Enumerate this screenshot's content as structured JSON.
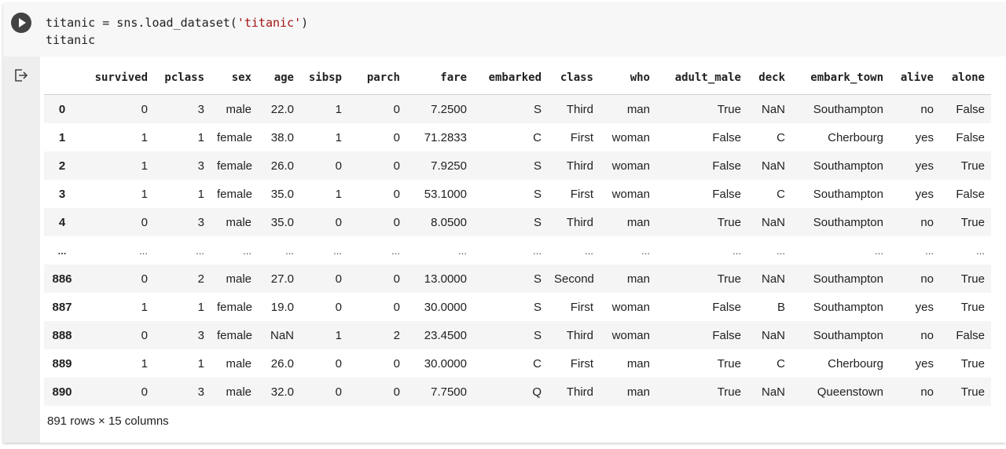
{
  "code": {
    "line1_prefix": "titanic = sns.load_dataset(",
    "line1_string": "'titanic'",
    "line1_suffix": ")",
    "line2": "titanic"
  },
  "icons": {
    "run": "play-circle-icon",
    "output": "output-redirect-icon"
  },
  "colors": {
    "code_bg": "#f7f7f7",
    "gutter_bg": "#eeeeee",
    "string": "#a31515",
    "row_stripe": "#f5f5f5"
  },
  "table": {
    "columns": [
      "",
      "survived",
      "pclass",
      "sex",
      "age",
      "sibsp",
      "parch",
      "fare",
      "embarked",
      "class",
      "who",
      "adult_male",
      "deck",
      "embark_town",
      "alive",
      "alone"
    ],
    "rows": [
      [
        "0",
        "0",
        "3",
        "male",
        "22.0",
        "1",
        "0",
        "7.2500",
        "S",
        "Third",
        "man",
        "True",
        "NaN",
        "Southampton",
        "no",
        "False"
      ],
      [
        "1",
        "1",
        "1",
        "female",
        "38.0",
        "1",
        "0",
        "71.2833",
        "C",
        "First",
        "woman",
        "False",
        "C",
        "Cherbourg",
        "yes",
        "False"
      ],
      [
        "2",
        "1",
        "3",
        "female",
        "26.0",
        "0",
        "0",
        "7.9250",
        "S",
        "Third",
        "woman",
        "False",
        "NaN",
        "Southampton",
        "yes",
        "True"
      ],
      [
        "3",
        "1",
        "1",
        "female",
        "35.0",
        "1",
        "0",
        "53.1000",
        "S",
        "First",
        "woman",
        "False",
        "C",
        "Southampton",
        "yes",
        "False"
      ],
      [
        "4",
        "0",
        "3",
        "male",
        "35.0",
        "0",
        "0",
        "8.0500",
        "S",
        "Third",
        "man",
        "True",
        "NaN",
        "Southampton",
        "no",
        "True"
      ],
      [
        "...",
        "...",
        "...",
        "...",
        "...",
        "...",
        "...",
        "...",
        "...",
        "...",
        "...",
        "...",
        "...",
        "...",
        "...",
        "..."
      ],
      [
        "886",
        "0",
        "2",
        "male",
        "27.0",
        "0",
        "0",
        "13.0000",
        "S",
        "Second",
        "man",
        "True",
        "NaN",
        "Southampton",
        "no",
        "True"
      ],
      [
        "887",
        "1",
        "1",
        "female",
        "19.0",
        "0",
        "0",
        "30.0000",
        "S",
        "First",
        "woman",
        "False",
        "B",
        "Southampton",
        "yes",
        "True"
      ],
      [
        "888",
        "0",
        "3",
        "female",
        "NaN",
        "1",
        "2",
        "23.4500",
        "S",
        "Third",
        "woman",
        "False",
        "NaN",
        "Southampton",
        "no",
        "False"
      ],
      [
        "889",
        "1",
        "1",
        "male",
        "26.0",
        "0",
        "0",
        "30.0000",
        "C",
        "First",
        "man",
        "True",
        "C",
        "Cherbourg",
        "yes",
        "True"
      ],
      [
        "890",
        "0",
        "3",
        "male",
        "32.0",
        "0",
        "0",
        "7.7500",
        "Q",
        "Third",
        "man",
        "True",
        "NaN",
        "Queenstown",
        "no",
        "True"
      ]
    ],
    "shape_text": "891 rows × 15 columns"
  }
}
